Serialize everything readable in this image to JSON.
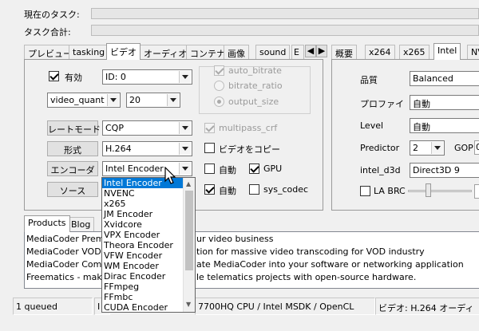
{
  "top": {
    "current_task_label": "現在のタスク:",
    "task_total_label": "タスク合計:"
  },
  "left_tabs": [
    "プレビュー",
    "tasking",
    "ビデオ",
    "オーディオ",
    "コンテナ",
    "画像",
    "sound",
    "E"
  ],
  "right_tabs": [
    "概要",
    "x264",
    "x265",
    "Intel",
    "NV"
  ],
  "video": {
    "enabled_label": "有効",
    "enabled": true,
    "id_value": "ID: 0",
    "quant_mode": "video_quant",
    "quant_value": "20",
    "rate_mode_label": "レートモード",
    "rate_mode_value": "CQP",
    "format_label": "形式",
    "format_value": "H.264",
    "encoder_label": "エンコーダ",
    "encoder_value": "Intel Encoder",
    "source_label": "ソース",
    "auto_bitrate": "auto_bitrate",
    "bitrate_ratio": "bitrate_ratio",
    "output_size": "output_size",
    "multipass": "multipass_crf",
    "video_copy": "ビデオをコピー",
    "auto_label_1": "自動",
    "gpu_label": "GPU",
    "auto_label_2": "自動",
    "sys_codec": "sys_codec"
  },
  "encoder_dropdown": {
    "items": [
      "Intel Encoder",
      "NVENC",
      "x265",
      "JM Encoder",
      "Xvidcore",
      "VPX Encoder",
      "Theora Encoder",
      "VFW Encoder",
      "WM Encoder",
      "Dirac Encoder",
      "FFmpeg",
      "FFmbc",
      "CUDA Encoder"
    ],
    "selected_index": 0
  },
  "intel": {
    "quality_label": "品質",
    "quality_value": "Balanced",
    "profile_label": "プロファイ",
    "profile_value": "自動",
    "level_label": "Level",
    "level_value": "自動",
    "predictor_label": "Predictor",
    "predictor_value": "2",
    "gop_label": "GOP",
    "gop_value": "0",
    "d3d_label": "intel_d3d",
    "d3d_value": "Direct3D 9",
    "la_brc_label": "LA BRC",
    "la_brc": false
  },
  "bottom_tabs": [
    "Products",
    "Blog"
  ],
  "products": [
    {
      "left": "MediaCoder Premiu",
      "right": "ur video business"
    },
    {
      "left": "MediaCoder VOD Ec",
      "right": "tion for massive video transcoding for VOD industry"
    },
    {
      "left": "MediaCoder Comma",
      "right": "ate MediaCoder into your software or networking application"
    },
    {
      "left": "Freematics - make it",
      "right": "le telematics projects with open-source hardware."
    }
  ],
  "status": {
    "queued": "1 queued",
    "cpu_prefix": "I",
    "cpu": "7700HQ CPU  / Intel MSDK / OpenCL",
    "video": "ビデオ: H.264  オーディ"
  },
  "colors": {
    "selection": "#0078d7",
    "window_bg": "#f0f0f0"
  }
}
